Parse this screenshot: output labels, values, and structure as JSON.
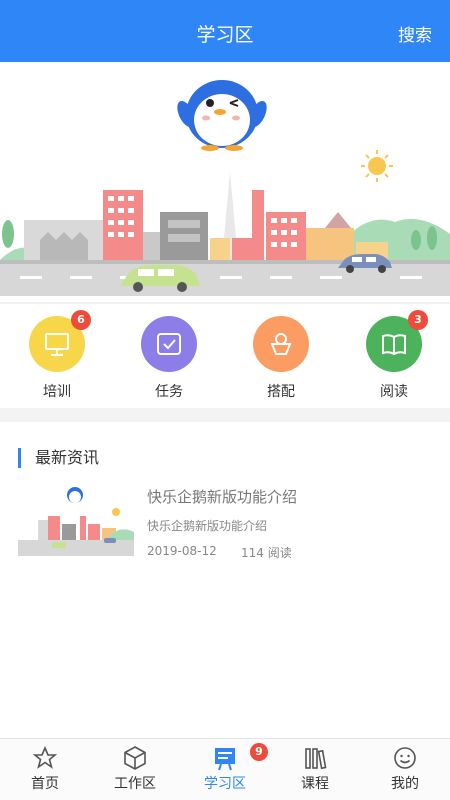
{
  "header": {
    "title": "学习区",
    "search_label": "搜索"
  },
  "categories": [
    {
      "label": "培训",
      "badge": "6",
      "color": "#f8d649"
    },
    {
      "label": "任务",
      "badge": "",
      "color": "#8d7de9"
    },
    {
      "label": "搭配",
      "badge": "",
      "color": "#fb9c63"
    },
    {
      "label": "阅读",
      "badge": "3",
      "color": "#4cb35c"
    }
  ],
  "news": {
    "section_title": "最新资讯",
    "articles": [
      {
        "title": "快乐企鹅新版功能介绍",
        "summary": "快乐企鹅新版功能介绍",
        "date": "2019-08-12",
        "reads": "114 阅读"
      }
    ]
  },
  "tabbar": {
    "items": [
      {
        "label": "首页",
        "badge": ""
      },
      {
        "label": "工作区",
        "badge": ""
      },
      {
        "label": "学习区",
        "badge": "9"
      },
      {
        "label": "课程",
        "badge": ""
      },
      {
        "label": "我的",
        "badge": ""
      }
    ],
    "active": "学习区"
  },
  "colors": {
    "primary": "#2f86f6",
    "badge": "#ee4b3a"
  }
}
